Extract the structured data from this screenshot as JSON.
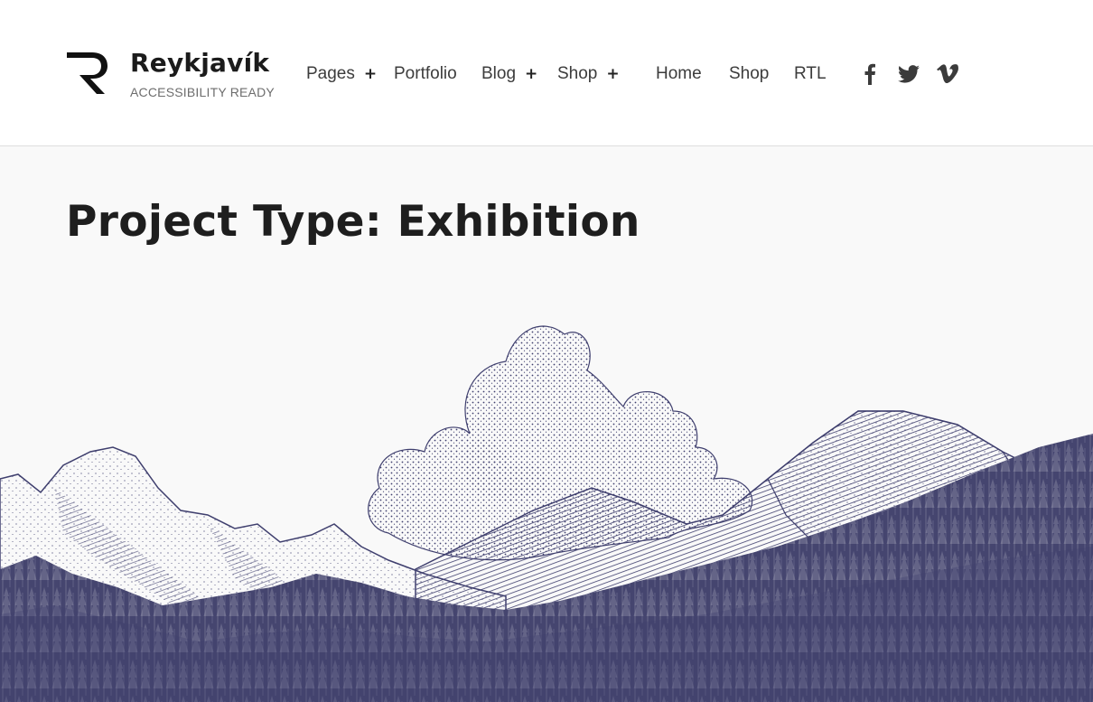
{
  "site": {
    "title": "Reykjavík",
    "tagline": "ACCESSIBILITY READY"
  },
  "nav": {
    "items": [
      {
        "label": "Pages",
        "has_submenu": true
      },
      {
        "label": "Portfolio",
        "has_submenu": false
      },
      {
        "label": "Blog",
        "has_submenu": true
      },
      {
        "label": "Shop",
        "has_submenu": true
      },
      {
        "label": "Home",
        "has_submenu": false
      },
      {
        "label": "Shop",
        "has_submenu": false
      },
      {
        "label": "RTL",
        "has_submenu": false
      }
    ],
    "submenu_indicator": "+"
  },
  "social": [
    "facebook-icon",
    "twitter-icon",
    "vimeo-icon"
  ],
  "page": {
    "title": "Project Type: Exhibition"
  },
  "colors": {
    "illustration": "#3f3f6e",
    "text": "#1e1e1e",
    "background": "#f9f9f9"
  }
}
